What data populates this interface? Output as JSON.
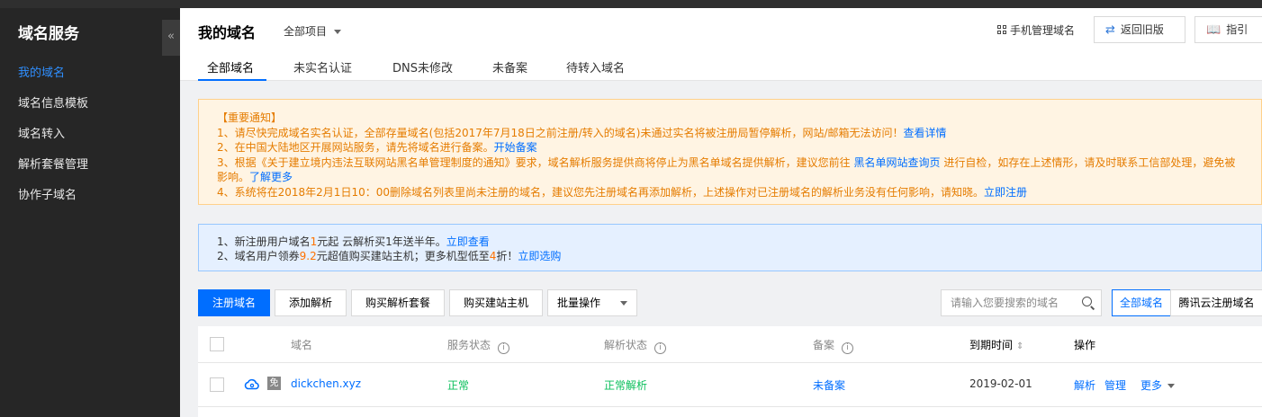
{
  "sidebar": {
    "title": "域名服务",
    "collapse_glyph": "«",
    "items": [
      {
        "label": "我的域名",
        "active": true
      },
      {
        "label": "域名信息模板"
      },
      {
        "label": "域名转入"
      },
      {
        "label": "解析套餐管理"
      },
      {
        "label": "协作子域名"
      }
    ]
  },
  "header": {
    "title": "我的域名",
    "project_select": "全部项目",
    "mobile_manage": "手机管理域名",
    "back_old": "返回旧版",
    "guide": "指引",
    "tabs": [
      {
        "label": "全部域名",
        "active": true
      },
      {
        "label": "未实名认证"
      },
      {
        "label": "DNS未修改"
      },
      {
        "label": "未备案"
      },
      {
        "label": "待转入域名"
      }
    ]
  },
  "notice": {
    "heading": "【重要通知】",
    "l1_text": "1、请尽快完成域名实名认证，全部存量域名(包括2017年7月18日之前注册/转入的域名)未通过实名将被注册局暂停解析，网站/邮箱无法访问！",
    "l1_link": "查看详情",
    "l2_text": "2、在中国大陆地区开展网站服务，请先将域名进行备案。",
    "l2_link": "开始备案",
    "l3_text_a": "3、根据《关于建立境内违法互联网站黑名单管理制度的通知》要求，域名解析服务提供商将停止为黑名单域名提供解析，建议您前往",
    "l3_link_a": "黑名单网站查询页",
    "l3_text_b": "进行自检，如存在上述情形，请及时联系工信部处理，避免被",
    "l3_text_c": "影响。",
    "l3_link_b": "了解更多",
    "l4_text": "4、系统将在2018年2月1日10：00删除域名列表里尚未注册的域名，建议您先注册域名再添加解析，上述操作对已注册域名的解析业务没有任何影响，请知晓。",
    "l4_link": "立即注册"
  },
  "promo": {
    "l1_a": "1、新注册用户域名",
    "l1_hl": "1",
    "l1_b": "元起 云解析买1年送半年。",
    "l1_link": "立即查看",
    "l2_a": "2、域名用户领券",
    "l2_hl1": "9.2",
    "l2_b": "元超值购买建站主机；更多机型低至",
    "l2_hl2": "4",
    "l2_c": "折！",
    "l2_link": "立即选购"
  },
  "toolbar": {
    "register": "注册域名",
    "add_resolve": "添加解析",
    "buy_package": "购买解析套餐",
    "buy_host": "购买建站主机",
    "batch": "批量操作",
    "search_placeholder": "请输入您要搜索的域名",
    "filter_all": "全部域名",
    "filter_tencent": "腾讯云注册域名"
  },
  "table": {
    "headers": {
      "domain": "域名",
      "service_status": "服务状态",
      "resolve_status": "解析状态",
      "icp": "备案",
      "expire": "到期时间",
      "ops": "操作"
    },
    "rows": [
      {
        "badge": "免",
        "domain": "dickchen.xyz",
        "service_status": "正常",
        "resolve_status": "正常解析",
        "icp": "未备案",
        "expire": "2019-02-01",
        "op_resolve": "解析",
        "op_manage": "管理",
        "op_more": "更多"
      }
    ]
  },
  "colors": {
    "primary": "#006eff",
    "success": "#0abf5b",
    "warning": "#e57c00",
    "sidebar_bg": "#262626"
  }
}
